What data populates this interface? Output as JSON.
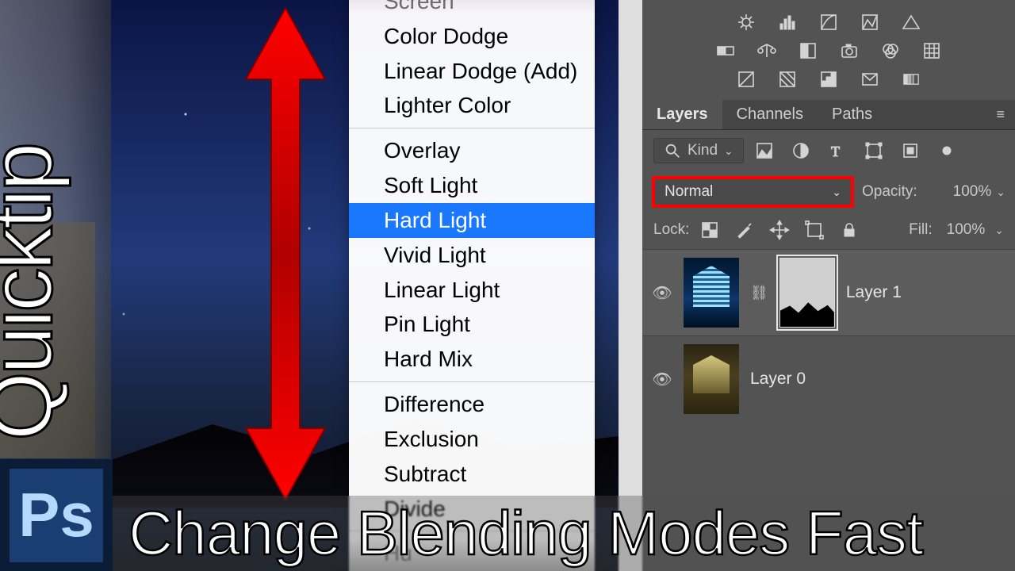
{
  "sidebar_label": "Quicktip",
  "ps_logo_text": "Ps",
  "caption": "Change Blending Modes Fast",
  "blend_menu": {
    "selected": "Hard Light",
    "groups": [
      [
        "Screen",
        "Color Dodge",
        "Linear Dodge (Add)",
        "Lighter Color"
      ],
      [
        "Overlay",
        "Soft Light",
        "Hard Light",
        "Vivid Light",
        "Linear Light",
        "Pin Light",
        "Hard Mix"
      ],
      [
        "Difference",
        "Exclusion",
        "Subtract",
        "Divide"
      ],
      [
        "Hu"
      ]
    ]
  },
  "panels": {
    "tabs": [
      "Layers",
      "Channels",
      "Paths"
    ],
    "active_tab": "Layers",
    "kind_label": "Kind",
    "blend_mode_value": "Normal",
    "opacity_label": "Opacity:",
    "opacity_value": "100%",
    "lock_label": "Lock:",
    "fill_label": "Fill:",
    "fill_value": "100%",
    "layers": [
      {
        "name": "Layer 1",
        "has_mask": true,
        "visible": true,
        "selected": true,
        "thumb": "bright"
      },
      {
        "name": "Layer 0",
        "has_mask": false,
        "visible": true,
        "selected": false,
        "thumb": "dim"
      }
    ]
  },
  "icon_names": {
    "row1": [
      "exposure-icon",
      "histogram-icon",
      "curves-icon",
      "levels-icon",
      "triangle-icon"
    ],
    "row2": [
      "gradient-map-icon",
      "balance-icon",
      "threshold-icon",
      "camera-icon",
      "channel-mixer-icon",
      "grid-icon"
    ],
    "row3": [
      "invert-icon",
      "pattern-icon",
      "posterize-icon",
      "envelope-icon",
      "gradient-icon"
    ],
    "filter": [
      "image-filter-icon",
      "adjustment-filter-icon",
      "text-filter-icon",
      "shape-filter-icon",
      "smartobj-filter-icon",
      "dot-icon"
    ],
    "lock": [
      "lock-transparent-icon",
      "lock-brush-icon",
      "lock-move-icon",
      "lock-artboard-icon",
      "lock-all-icon"
    ]
  }
}
